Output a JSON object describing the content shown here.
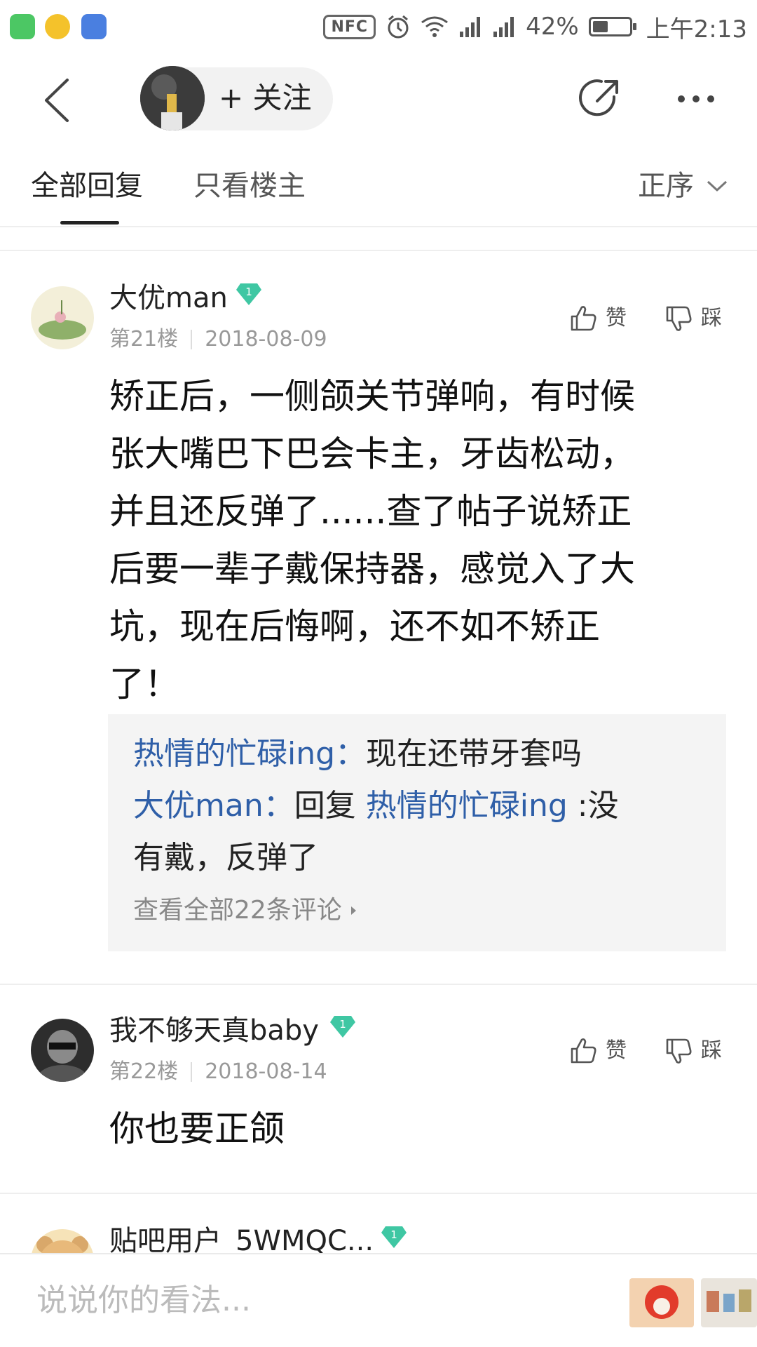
{
  "status_bar": {
    "nfc": "NFC",
    "battery_percent": "42%",
    "battery_level": 0.42,
    "time": "上午2:13"
  },
  "nav": {
    "follow_label": "+ 关注"
  },
  "tabs": {
    "all_replies": "全部回复",
    "op_only": "只看楼主",
    "sort": "正序"
  },
  "posts": [
    {
      "username": "大优man",
      "level": "1",
      "floor": "第21楼",
      "date": "2018-08-09",
      "like_label": "赞",
      "dislike_label": "踩",
      "content_lines": [
        "矫正后，一侧颌关节弹响，有时候",
        "张大嘴巴下巴会卡主，牙齿松动，",
        "并且还反弹了......查了帖子说矫正",
        "后要一辈子戴保持器，感觉入了大",
        "坑，现在后悔啊，还不如不矫正",
        "了！"
      ],
      "replies": {
        "r1_user": "热情的忙碌ing：",
        "r1_text": "现在还带牙套吗",
        "r2_user": "大优man：",
        "r2_prefix": "回复 ",
        "r2_target": "热情的忙碌ing",
        "r2_text_a": " :没",
        "r2_text_b": "有戴，反弹了",
        "view_all": "查看全部22条评论"
      }
    },
    {
      "username": "我不够天真baby",
      "level": "1",
      "floor": "第22楼",
      "date": "2018-08-14",
      "like_label": "赞",
      "dislike_label": "踩",
      "content": "你也要正颌"
    },
    {
      "username": "贴吧用户_5WMQC...",
      "level": "1"
    }
  ],
  "bottom_bar": {
    "input_placeholder": "说说你的看法..."
  },
  "icons": {
    "back": "back-arrow-icon",
    "share": "share-icon",
    "more": "more-icon",
    "like": "thumbs-up-icon",
    "dislike": "thumbs-down-icon",
    "level_badge": "diamond-badge-icon",
    "sort": "chevron-down-icon"
  },
  "colors": {
    "link_blue": "#2f5fa8",
    "badge_green": "#3fc7a3",
    "reply_bg": "#f4f4f4"
  }
}
